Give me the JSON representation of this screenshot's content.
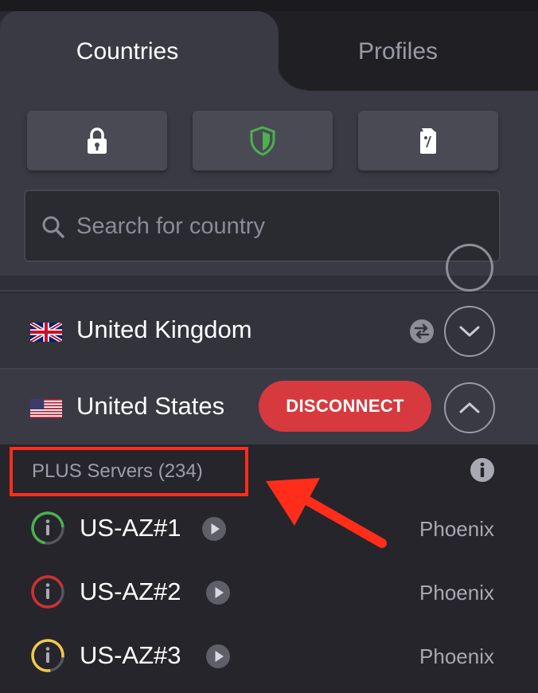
{
  "tabs": [
    {
      "label": "Countries",
      "active": true
    },
    {
      "label": "Profiles",
      "active": false
    }
  ],
  "quick_connect": [
    {
      "icon": "lock-icon"
    },
    {
      "icon": "shield-icon"
    },
    {
      "icon": "random-connect-icon"
    }
  ],
  "search": {
    "placeholder": "Search for country",
    "value": ""
  },
  "countries": [
    {
      "name": "United Kingdom",
      "flag": "uk-flag-icon",
      "features": [
        "p2p-icon"
      ],
      "expanded": false
    },
    {
      "name": "United States",
      "flag": "us-flag-icon",
      "expanded": true,
      "action_label": "DISCONNECT"
    }
  ],
  "server_group": {
    "header": "PLUS Servers (234)",
    "servers": [
      {
        "name": "US-AZ#1",
        "city": "Phoenix",
        "load_color": "#4caf50"
      },
      {
        "name": "US-AZ#2",
        "city": "Phoenix",
        "load_color": "#d32f2f"
      },
      {
        "name": "US-AZ#3",
        "city": "Phoenix",
        "load_color": "#f2c94c"
      }
    ]
  },
  "colors": {
    "accent_red": "#d63a3f",
    "annotation_red": "#ff2d1a",
    "shield_green": "#4caf50",
    "panel": "#3a3a44",
    "list_bg": "#25252b"
  }
}
